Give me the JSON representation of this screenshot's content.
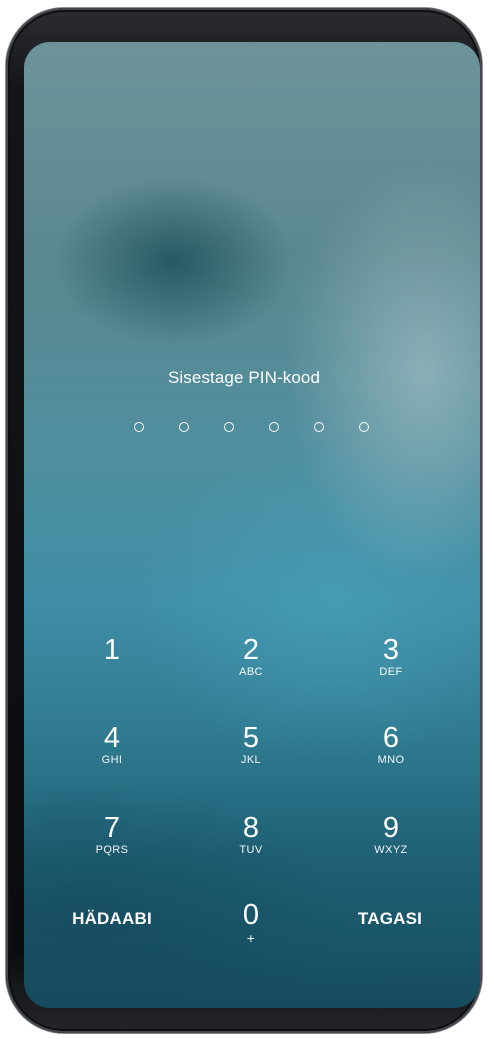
{
  "lockscreen": {
    "prompt": "Sisestage PIN-kood",
    "pin_length": 6,
    "pin_entered": 0
  },
  "keypad": {
    "keys": [
      {
        "digit": "1",
        "letters": ""
      },
      {
        "digit": "2",
        "letters": "ABC"
      },
      {
        "digit": "3",
        "letters": "DEF"
      },
      {
        "digit": "4",
        "letters": "GHI"
      },
      {
        "digit": "5",
        "letters": "JKL"
      },
      {
        "digit": "6",
        "letters": "MNO"
      },
      {
        "digit": "7",
        "letters": "PQRS"
      },
      {
        "digit": "8",
        "letters": "TUV"
      },
      {
        "digit": "9",
        "letters": "WXYZ"
      },
      {
        "digit": "0",
        "letters": "+"
      }
    ],
    "emergency_label": "HÄDAABI",
    "back_label": "TAGASI"
  }
}
